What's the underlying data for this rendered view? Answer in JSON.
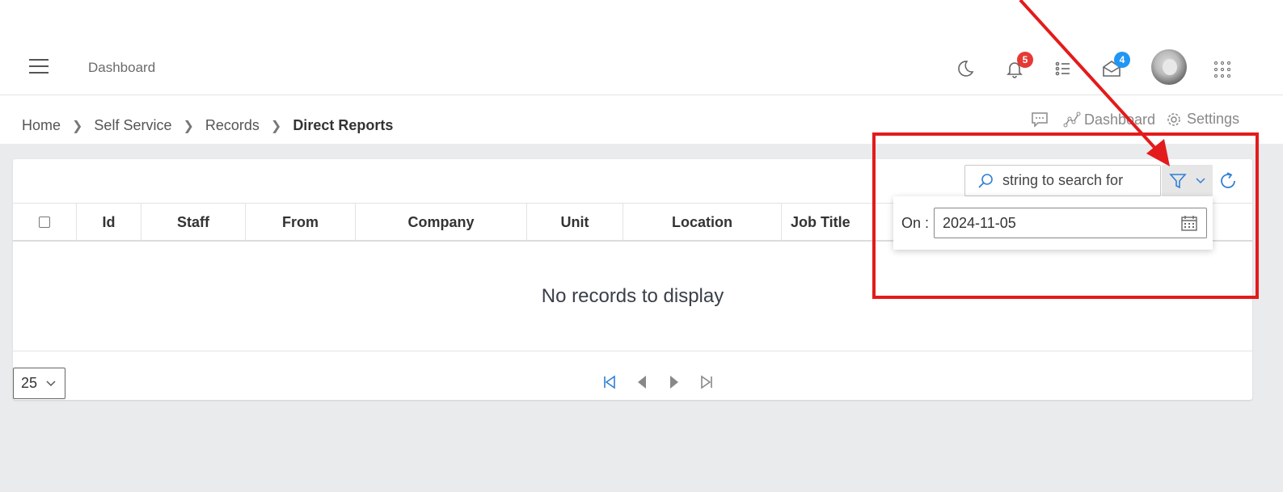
{
  "header": {
    "title": "Dashboard",
    "notifications_count": "5",
    "messages_count": "4"
  },
  "breadcrumb": {
    "items": [
      "Home",
      "Self Service",
      "Records"
    ],
    "current": "Direct Reports"
  },
  "top_actions": {
    "dashboard_label": "Dashboard",
    "settings_label": "Settings"
  },
  "toolbar": {
    "search_placeholder": "string to search for"
  },
  "filter_popup": {
    "on_label": "On :",
    "date_value": "2024-11-05"
  },
  "table": {
    "columns": [
      "Id",
      "Staff",
      "From",
      "Company",
      "Unit",
      "Location",
      "Job Title"
    ],
    "empty_message": "No records to display"
  },
  "pager": {
    "page_size": "25"
  },
  "colors": {
    "annotation_red": "#e31b1b",
    "accent_blue": "#2f7fd6",
    "badge_red": "#e53935",
    "badge_blue": "#2196f3"
  }
}
